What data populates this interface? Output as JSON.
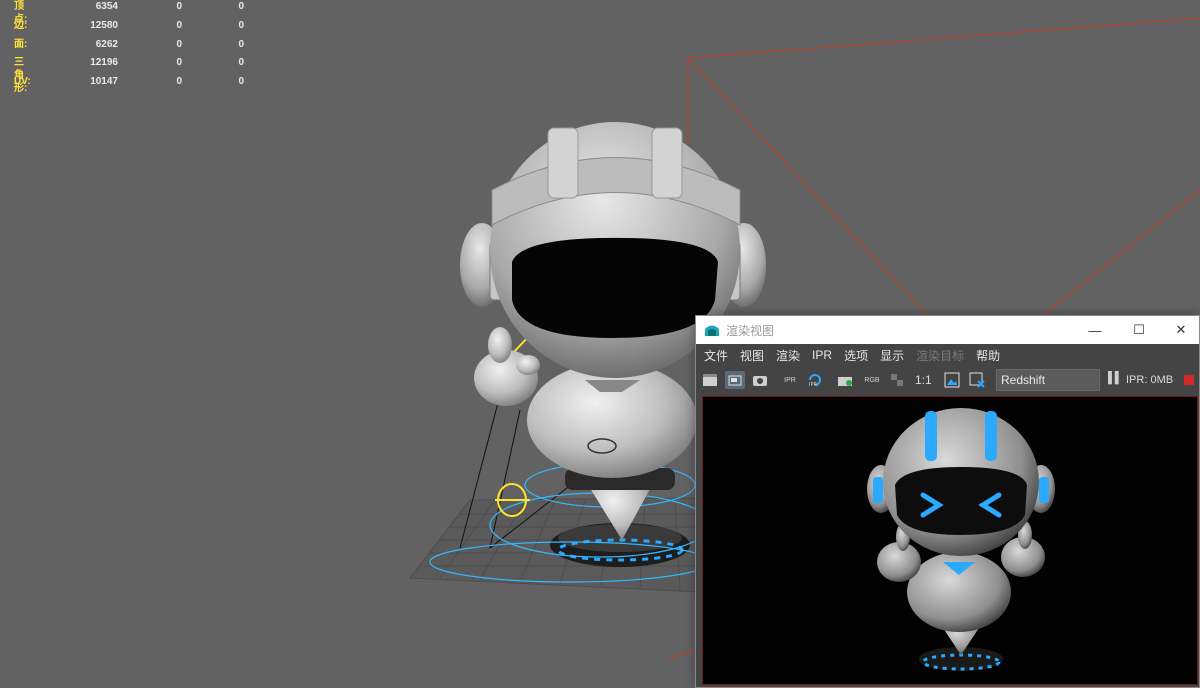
{
  "hud": {
    "rows": [
      {
        "label": "顶点:",
        "v1": "6354",
        "v2": "0",
        "v3": "0"
      },
      {
        "label": "边:",
        "v1": "12580",
        "v2": "0",
        "v3": "0"
      },
      {
        "label": "面:",
        "v1": "6262",
        "v2": "0",
        "v3": "0"
      },
      {
        "label": "三角形:",
        "v1": "12196",
        "v2": "0",
        "v3": "0"
      },
      {
        "label": "UV:",
        "v1": "10147",
        "v2": "0",
        "v3": "0"
      }
    ]
  },
  "render_view": {
    "title": "渲染视图",
    "menu": [
      "文件",
      "视图",
      "渲染",
      "IPR",
      "选项",
      "显示",
      "渲染目标",
      "帮助"
    ],
    "menu_disabled": [
      "渲染目标"
    ],
    "toolbar": {
      "icons": [
        "render-frame-icon",
        "render-region-icon",
        "snapshot-icon",
        "ipr-render-icon",
        "refresh-ipr-icon",
        "render-sequence-icon",
        "rgb-channels-icon",
        "alpha-channel-icon",
        "real-size-icon",
        "display-image-icon",
        "remove-image-icon"
      ],
      "ratio_label": "1:1",
      "renderer": "Redshift",
      "ipr_status": "IPR: 0MB"
    }
  },
  "colors": {
    "viewport_bg": "#626262",
    "hud_label": "#ffe23a",
    "accent_cyan": "#2aa9ff",
    "camera_frustum": "#b4432a"
  }
}
